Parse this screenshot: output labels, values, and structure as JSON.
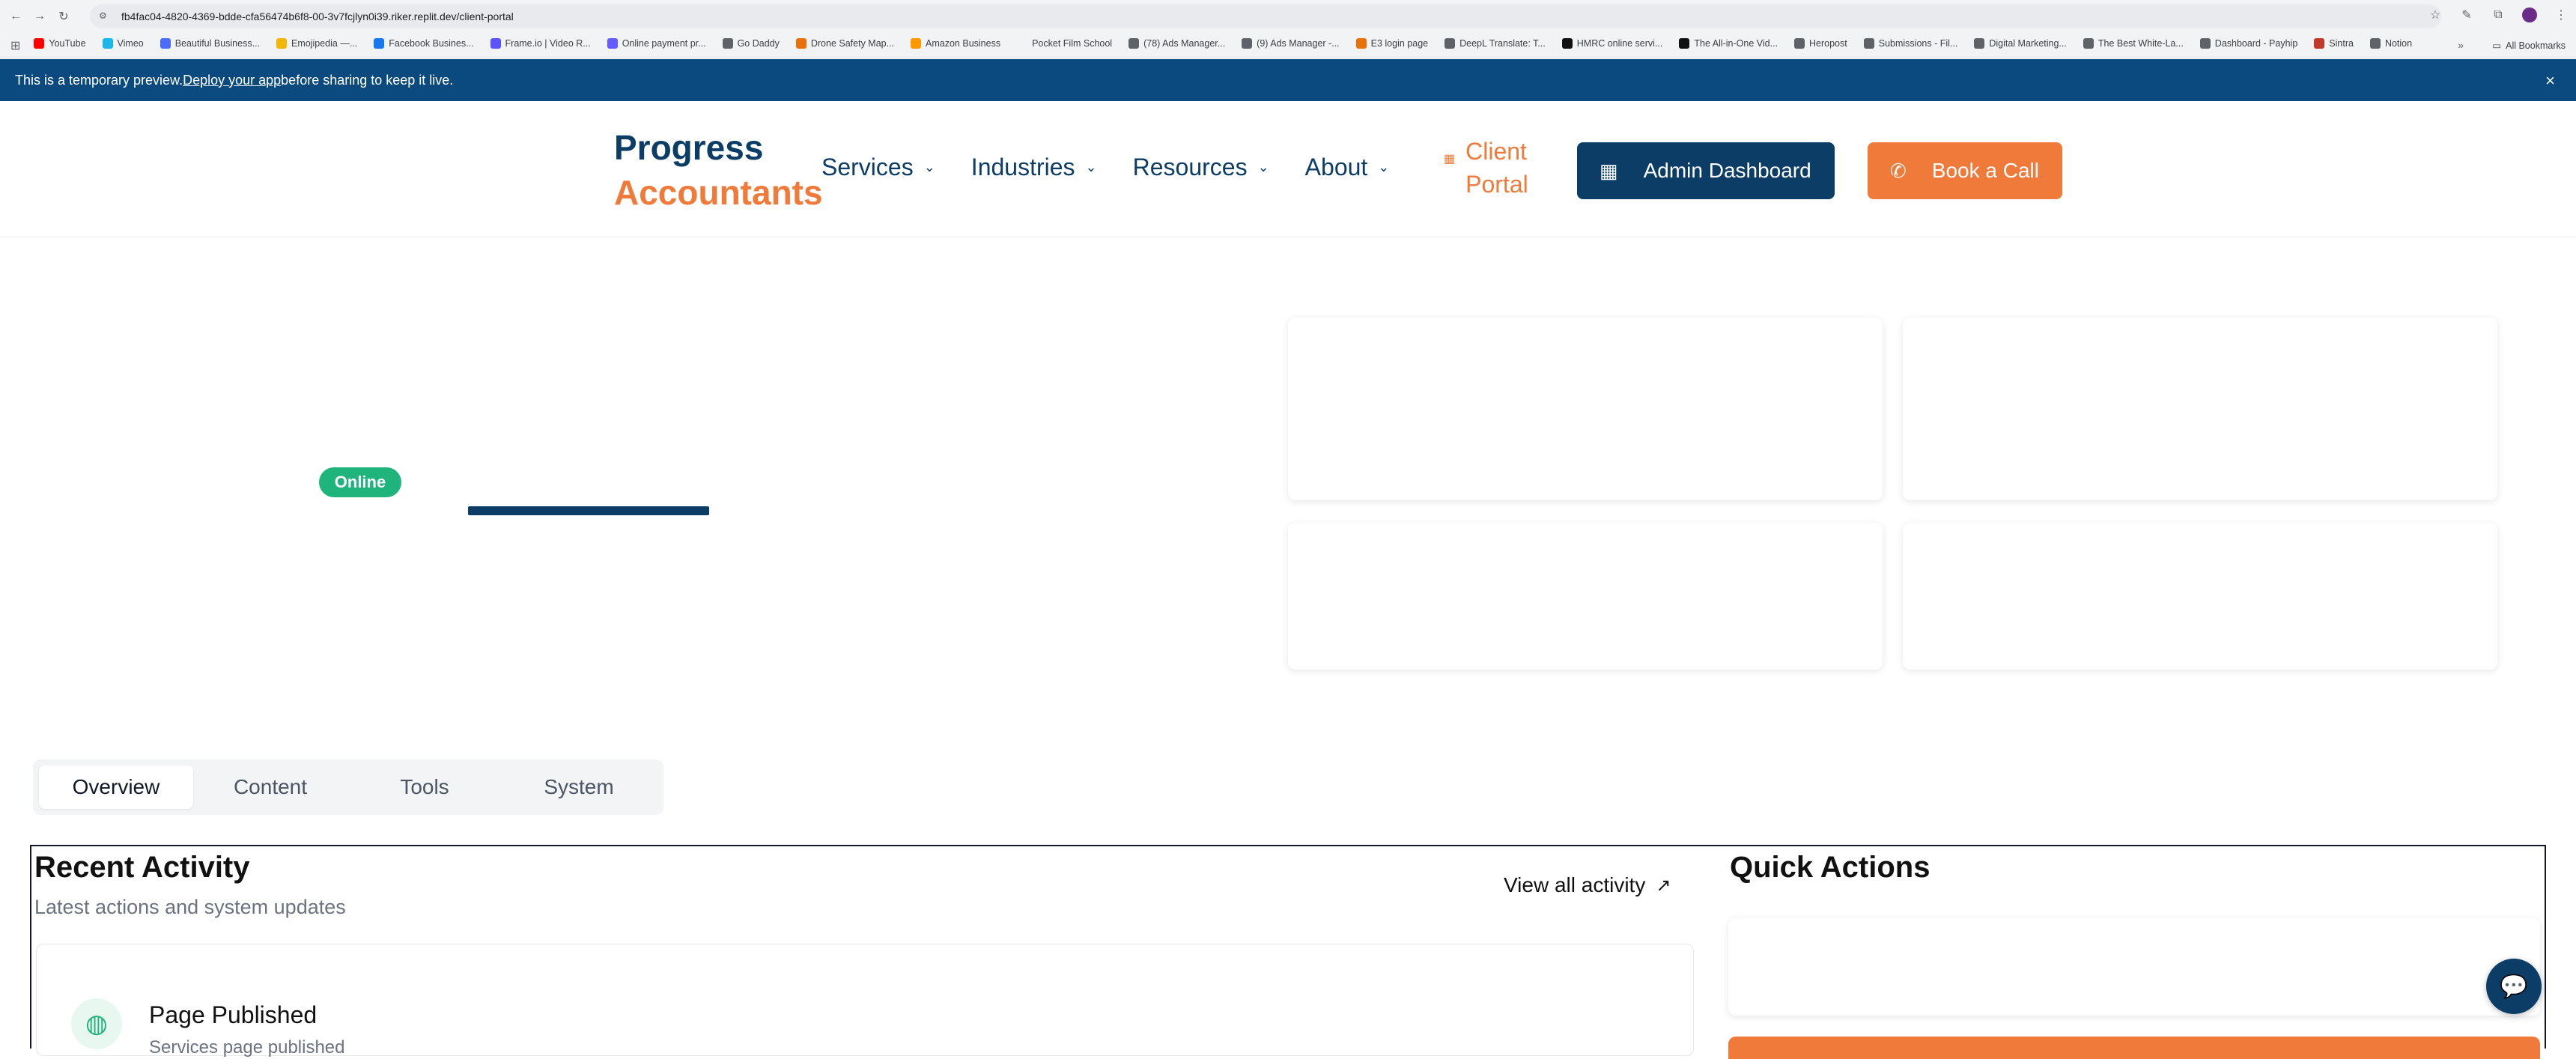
{
  "browser": {
    "url": "fb4fac04-4820-4369-bdde-cfa56474b6f8-00-3v7fcjlyn0i39.riker.replit.dev/client-portal",
    "bookmarks": [
      {
        "label": "YouTube",
        "color": "#ff0000"
      },
      {
        "label": "Vimeo",
        "color": "#1ab7ea"
      },
      {
        "label": "Beautiful Business...",
        "color": "#4a6cf7"
      },
      {
        "label": "Emojipedia —...",
        "color": "#f2b705"
      },
      {
        "label": "Facebook Busines...",
        "color": "#1877f2"
      },
      {
        "label": "Frame.io | Video R...",
        "color": "#5b53ff"
      },
      {
        "label": "Online payment pr...",
        "color": "#635bff"
      },
      {
        "label": "Go Daddy",
        "color": "#5f6368"
      },
      {
        "label": "Drone Safety Map...",
        "color": "#e8710a"
      },
      {
        "label": "Amazon Business",
        "color": "#ff9900"
      },
      {
        "label": "Pocket Film School",
        "color": "#f1f3f4"
      },
      {
        "label": "(78) Ads Manager...",
        "color": "#5f6368"
      },
      {
        "label": "(9) Ads Manager -...",
        "color": "#5f6368"
      },
      {
        "label": "E3 login page",
        "color": "#e8710a"
      },
      {
        "label": "DeepL Translate: T...",
        "color": "#5f6368"
      },
      {
        "label": "HMRC online servi...",
        "color": "#111111"
      },
      {
        "label": "The All-in-One Vid...",
        "color": "#111111"
      },
      {
        "label": "Heropost",
        "color": "#5f6368"
      },
      {
        "label": "Submissions - Fil...",
        "color": "#5f6368"
      },
      {
        "label": "Digital Marketing...",
        "color": "#5f6368"
      },
      {
        "label": "The Best White-La...",
        "color": "#5f6368"
      },
      {
        "label": "Dashboard - Payhip",
        "color": "#5f6368"
      },
      {
        "label": "Sintra",
        "color": "#c0392b"
      },
      {
        "label": "Notion",
        "color": "#5f6368"
      }
    ],
    "more": "»",
    "all_bookmarks": "All Bookmarks"
  },
  "banner": {
    "prefix": "This is a temporary preview. ",
    "link": "Deploy your app",
    "suffix": " before sharing to keep it live.",
    "close": "×"
  },
  "header": {
    "logo_line1": "Progress",
    "logo_line2": "Accountants",
    "nav": [
      {
        "label": "Services"
      },
      {
        "label": "Industries"
      },
      {
        "label": "Resources"
      },
      {
        "label": "About"
      }
    ],
    "client_portal": "Client Portal",
    "admin_button": "Admin Dashboard",
    "call_button": "Book a Call"
  },
  "hero": {
    "status_badge": "Online",
    "progress_percent": 100
  },
  "tabs": [
    {
      "label": "Overview",
      "active": true
    },
    {
      "label": "Content",
      "active": false
    },
    {
      "label": "Tools",
      "active": false
    },
    {
      "label": "System",
      "active": false
    }
  ],
  "activity": {
    "title": "Recent Activity",
    "subtitle": "Latest actions and system updates",
    "view_all": "View all activity",
    "items": [
      {
        "title": "Page Published",
        "description": "Services page published"
      }
    ]
  },
  "quick_actions": {
    "title": "Quick Actions"
  },
  "colors": {
    "navy": "#0b3d66",
    "orange": "#f07a3a",
    "green": "#1fb47b",
    "banner": "#0a4a7e"
  }
}
